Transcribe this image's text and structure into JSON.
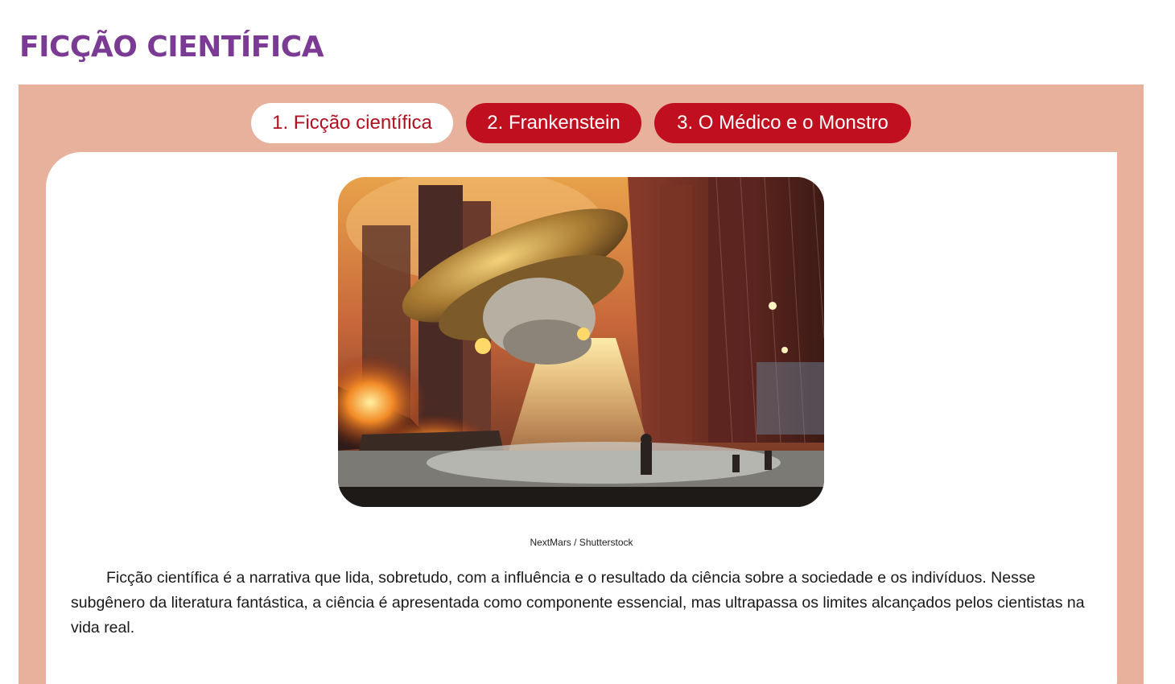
{
  "page": {
    "title": "FICÇÃO CIENTÍFICA"
  },
  "tabs": [
    {
      "label": "1. Ficção científica",
      "active": true
    },
    {
      "label": "2. Frankenstein",
      "active": false
    },
    {
      "label": "3. O Médico e o Monstro",
      "active": false
    }
  ],
  "figure": {
    "credit": "NextMars / Shutterstock"
  },
  "article": {
    "paragraph": "Ficção científica é a narrativa que lida, sobretudo, com a influência e o resultado da ciência sobre a sociedade e os indivíduos. Nesse subgênero da literatura fantástica, a ciência é apresentada como componente essencial, mas ultrapassa os limites alcançados pelos cientistas na vida real."
  },
  "colors": {
    "title": "#7b3a93",
    "frame": "#e7b19c",
    "tab_inactive": "#c0101f",
    "tab_active_text": "#b0101f"
  }
}
